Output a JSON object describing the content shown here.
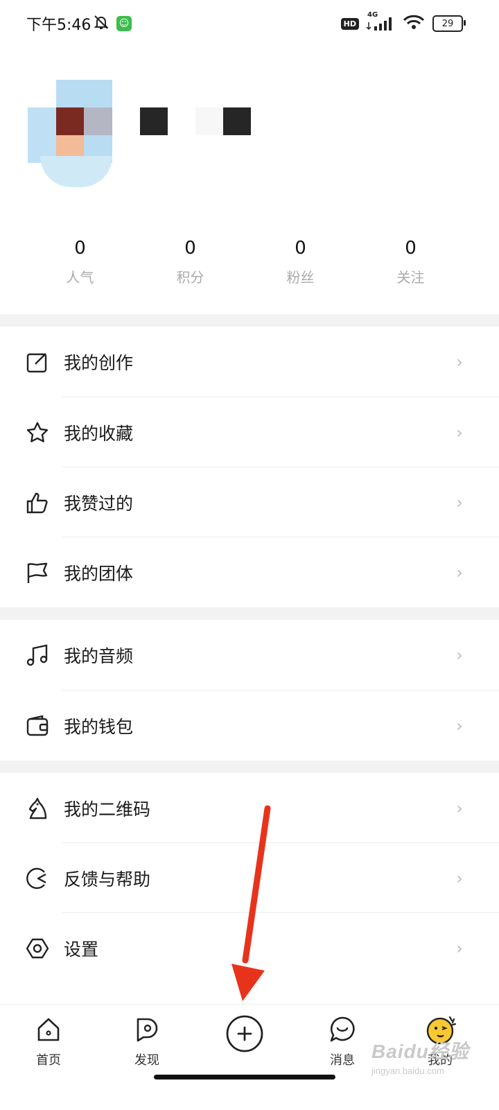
{
  "status_bar": {
    "time": "下午5:46",
    "hd": "HD",
    "network": "4G",
    "battery": "29",
    "icons": [
      "bell-off-icon",
      "wechat-icon",
      "signal-icon",
      "wifi-icon",
      "battery-icon"
    ]
  },
  "stats": [
    {
      "value": "0",
      "label": "人气"
    },
    {
      "value": "0",
      "label": "积分"
    },
    {
      "value": "0",
      "label": "粉丝"
    },
    {
      "value": "0",
      "label": "关注"
    }
  ],
  "menu": [
    {
      "label": "我的创作",
      "icon": "edit-icon"
    },
    {
      "label": "我的收藏",
      "icon": "star-icon"
    },
    {
      "label": "我赞过的",
      "icon": "thumbs-up-icon"
    },
    {
      "label": "我的团体",
      "icon": "flag-icon"
    },
    {
      "label": "我的音频",
      "icon": "music-icon"
    },
    {
      "label": "我的钱包",
      "icon": "wallet-icon"
    },
    {
      "label": "我的二维码",
      "icon": "chess-knight-icon"
    },
    {
      "label": "反馈与帮助",
      "icon": "feedback-icon"
    },
    {
      "label": "设置",
      "icon": "settings-icon"
    }
  ],
  "tabs": [
    {
      "label": "首页",
      "icon": "home-icon"
    },
    {
      "label": "发现",
      "icon": "discover-icon"
    },
    {
      "label": "",
      "icon": "add-circle-icon"
    },
    {
      "label": "消息",
      "icon": "message-icon"
    },
    {
      "label": "我的",
      "icon": "profile-face-icon"
    }
  ],
  "watermark": {
    "main": "Baidu经验",
    "sub": "jingyan.baidu.com"
  },
  "colors": {
    "accent_arrow": "#e8331c",
    "chevron": "#bbbbbb",
    "stat_label": "#aaaaaa",
    "section_gap": "#f2f2f2",
    "wechat_green": "#3dbb4c",
    "profile_yellow": "#f9c933"
  }
}
